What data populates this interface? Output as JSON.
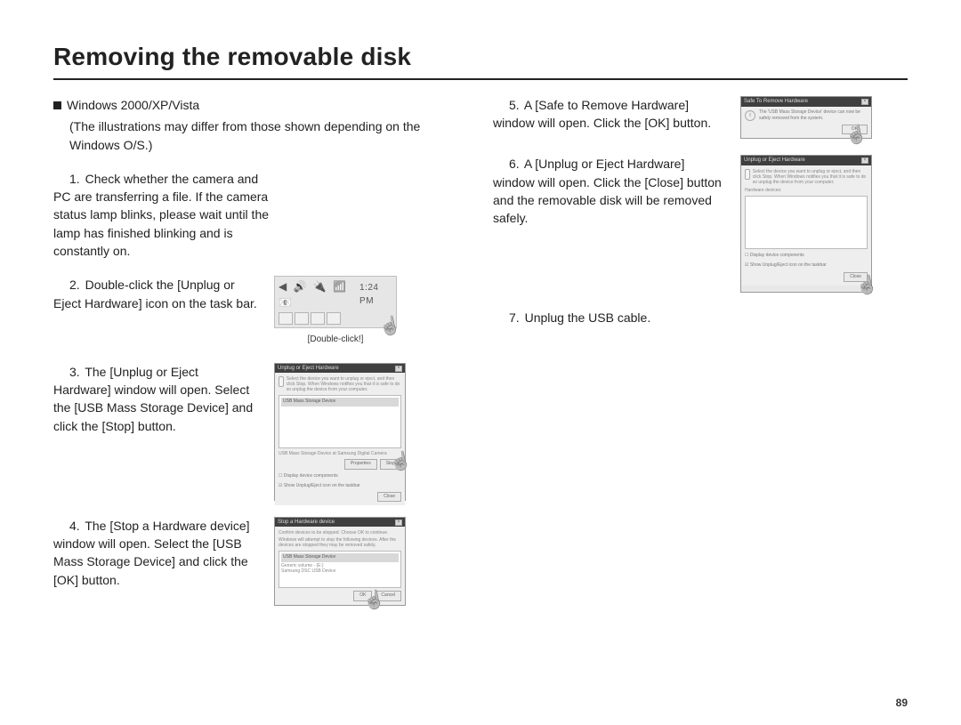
{
  "title": "Removing the removable disk",
  "page_number": "89",
  "left": {
    "subhead": "Windows 2000/XP/Vista",
    "paren": "(The illustrations may differ from those shown depending on the Windows O/S.)",
    "step1": {
      "num": "1.",
      "text": "Check whether the camera and PC are transferring a file. If the camera status lamp blinks, please wait until the lamp has finished blinking and is constantly on."
    },
    "step2": {
      "num": "2.",
      "text": "Double-click the [Unplug or Eject Hardware] icon on the task bar."
    },
    "fig2": {
      "time": "1:24 PM",
      "caption": "[Double-click!]"
    },
    "step3": {
      "num": "3.",
      "text": "The [Unplug or Eject Hardware] window will open. Select the [USB Mass Storage Device] and click the [Stop] button."
    },
    "dlg3": {
      "title": "Unplug or Eject Hardware",
      "desc": "Select the device you want to unplug or eject, and then click Stop. When Windows notifies you that it is safe to do so unplug the device from your computer.",
      "listitem": "USB Mass Storage Device",
      "status": "USB Mass Storage Device at Samsung Digital Camera",
      "btn_properties": "Properties",
      "btn_stop": "Stop",
      "chk1": "Display device components",
      "chk2": "Show Unplug/Eject icon on the taskbar",
      "btn_close": "Close"
    },
    "step4": {
      "num": "4.",
      "text": "The [Stop a Hardware device] window will open. Select the [USB Mass Storage Device] and click the [OK] button."
    },
    "dlg4": {
      "title": "Stop a Hardware device",
      "desc": "Confirm devices to be stopped. Choose OK to continue.",
      "desc2": "Windows will attempt to stop the following devices. After the devices are stopped they may be removed safely.",
      "item1": "USB Mass Storage Device",
      "item2": "Generic volume - (E:)",
      "item3": "Samsung DSC USB Device",
      "btn_ok": "OK",
      "btn_cancel": "Cancel"
    }
  },
  "right": {
    "step5": {
      "num": "5.",
      "text": "A [Safe to Remove Hardware] window will open. Click the [OK] button."
    },
    "dlg5": {
      "title": "Safe To Remove Hardware",
      "text": "The 'USB Mass Storage Device' device can now be safely removed from the system.",
      "btn_ok": "OK"
    },
    "step6": {
      "num": "6.",
      "text": "A [Unplug or Eject Hardware] window will open. Click the [Close] button and the removable disk will be removed safely."
    },
    "dlg6": {
      "title": "Unplug or Eject Hardware",
      "desc": "Select the device you want to unplug or eject, and then click Stop. When Windows notifies you that it is safe to do so unplug the device from your computer.",
      "label": "Hardware devices:",
      "chk1": "Display device components",
      "chk2": "Show Unplug/Eject icon on the taskbar",
      "btn_close": "Close"
    },
    "step7": {
      "num": "7.",
      "text": "Unplug the USB cable."
    }
  }
}
